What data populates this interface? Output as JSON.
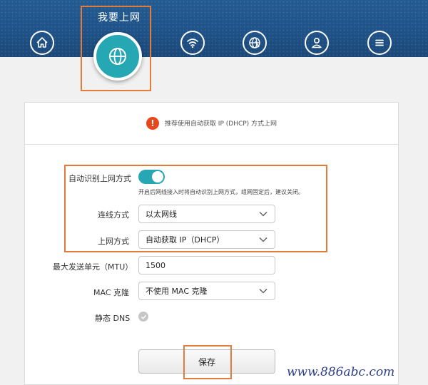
{
  "header": {
    "active_title": "我要上网",
    "nav_icons": [
      "home-icon",
      "globe-icon",
      "wifi-icon",
      "globe-settings-icon",
      "user-icon",
      "menu-icon"
    ]
  },
  "notice": {
    "icon": "!",
    "text": "推荐使用自动获取 IP (DHCP) 方式上网"
  },
  "form": {
    "auto_detect_label": "自动识别上网方式",
    "auto_detect_on": true,
    "auto_detect_hint": "开启后网线接入时将自动识别上网方式，组网固定后，建议关闭。",
    "connection_label": "连线方式",
    "connection_value": "以太网线",
    "internet_label": "上网方式",
    "internet_value": "自动获取 IP（DHCP）",
    "mtu_label": "最大发送单元（MTU）",
    "mtu_value": "1500",
    "mac_label": "MAC 克隆",
    "mac_value": "不使用 MAC 克隆",
    "dns_label": "静态 DNS",
    "dns_checked": false,
    "save_label": "保存"
  },
  "watermark": "www.886abc.com",
  "colors": {
    "header": "#1f5288",
    "accent": "#26a8b4",
    "highlight": "#e27c3a",
    "warning": "#e8471c"
  }
}
